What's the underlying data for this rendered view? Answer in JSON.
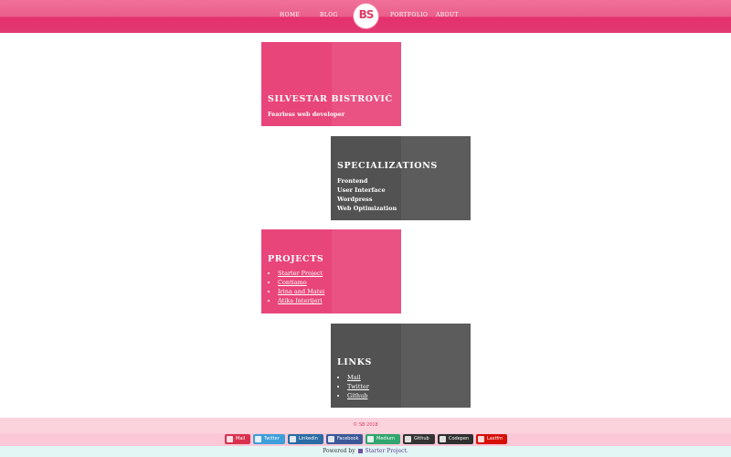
{
  "nav": {
    "home": "HOME",
    "blog": "BLOG",
    "logo": "BS",
    "portfolio": "PORTFOLIO",
    "about": "ABOUT"
  },
  "intro": {
    "title": "SILVESTAR BISTROVIĆ",
    "subtitle": "Fearless web developer"
  },
  "specializations": {
    "title": "SPECIALIZATIONS",
    "items": [
      "Frontend",
      "User Interface",
      "Wordpress",
      "Web Optimization"
    ]
  },
  "projects": {
    "title": "PROJECTS",
    "items": [
      "Starter Project",
      "Contiamo",
      "Irina and Matei",
      "Atika Interijeri"
    ]
  },
  "links": {
    "title": "LINKS",
    "items": [
      "Mail",
      "Twitter",
      "Github"
    ]
  },
  "footer": {
    "copyright": "© SB 2018",
    "socials": [
      {
        "label": "Mail",
        "icon": "mail-icon",
        "color": "#d8314f"
      },
      {
        "label": "Twitter",
        "icon": "twitter-icon",
        "color": "#3d9ed9"
      },
      {
        "label": "Linkedin",
        "icon": "linkedin-icon",
        "color": "#2b6ca3"
      },
      {
        "label": "Facebook",
        "icon": "facebook-icon",
        "color": "#3b5998"
      },
      {
        "label": "Medium",
        "icon": "medium-icon",
        "color": "#2fa66e"
      },
      {
        "label": "Github",
        "icon": "github-icon",
        "color": "#333333"
      },
      {
        "label": "Codepen",
        "icon": "codepen-icon",
        "color": "#2f2f2f"
      },
      {
        "label": "Lastfm",
        "icon": "lastfm-icon",
        "color": "#d51007"
      }
    ],
    "powered_prefix": "Powered by",
    "powered_link": "Starter Project."
  },
  "colors": {
    "brand_pink": "#e8457a",
    "card_gray": "#525252"
  }
}
